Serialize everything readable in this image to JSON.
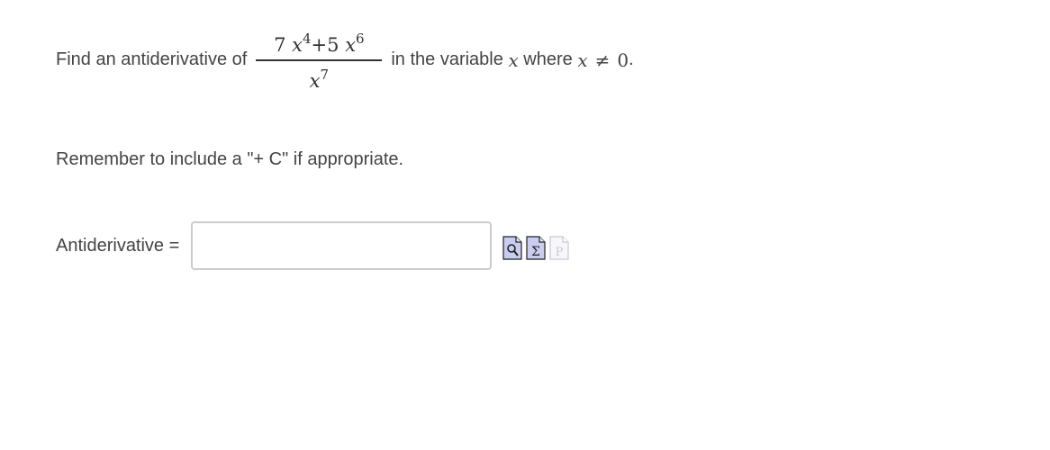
{
  "problem": {
    "prefix": "Find an antiderivative of",
    "fraction": {
      "num_coef1": "7",
      "num_var1": "x",
      "num_exp1": "4",
      "num_op": "+5",
      "num_var2": "x",
      "num_exp2": "6",
      "den_var": "x",
      "den_exp": "7"
    },
    "suffix1": "in the variable",
    "var": "x",
    "suffix2": "where",
    "cond_var": "x",
    "cond_op": "≠",
    "cond_val": "0",
    "period": "."
  },
  "reminder": "Remember to include a \"+ C\" if appropriate.",
  "answer": {
    "label": "Antiderivative =",
    "value": "",
    "placeholder": ""
  },
  "icons": [
    "preview-icon",
    "equation-editor-icon",
    "pdf-icon"
  ]
}
